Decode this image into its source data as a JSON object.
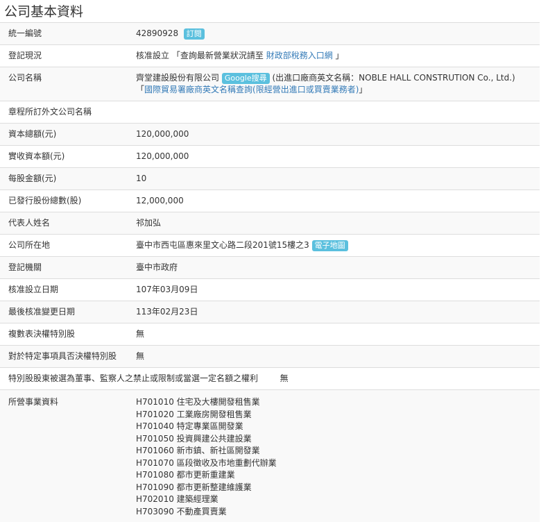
{
  "page_title": "公司基本資料",
  "rows": {
    "unified_number": {
      "label": "統一編號",
      "value": "42890928",
      "subscribe": "訂閱"
    },
    "registration_status": {
      "label": "登記現況",
      "status": "核准設立",
      "open_quote": "「查詢最新營業狀況請至",
      "link": "財政部稅務入口網",
      "close_quote": "」"
    },
    "company_name": {
      "label": "公司名稱",
      "name": "齊堂建設股份有限公司",
      "google_search": "Google搜尋",
      "english_prefix": "(出進口廠商英文名稱：NOBLE HALL CONSTRUTION Co., Ltd.)",
      "open_quote": "「",
      "trade_link": "國際貿易署廠商英文名稱查詢(限經營出進口或買賣業務者)",
      "close_quote": "」"
    },
    "foreign_name": {
      "label": "章程所訂外文公司名稱",
      "value": ""
    },
    "capital_total": {
      "label": "資本總額(元)",
      "value": "120,000,000"
    },
    "paid_in_capital": {
      "label": "實收資本額(元)",
      "value": "120,000,000"
    },
    "par_value": {
      "label": "每股金額(元)",
      "value": "10"
    },
    "issued_shares": {
      "label": "已發行股份總數(股)",
      "value": "12,000,000"
    },
    "representative": {
      "label": "代表人姓名",
      "value": "祁加弘"
    },
    "address": {
      "label": "公司所在地",
      "value": "臺中市西屯區惠來里文心路二段201號15樓之3",
      "map": "電子地圖"
    },
    "authority": {
      "label": "登記機關",
      "value": "臺中市政府"
    },
    "approval_date": {
      "label": "核准設立日期",
      "value": "107年03月09日"
    },
    "last_change_date": {
      "label": "最後核准變更日期",
      "value": "113年02月23日"
    },
    "multi_vote_shares": {
      "label": "複數表決權特別股",
      "value": "無"
    },
    "veto_shares": {
      "label": "對於特定事項具否決權特別股",
      "value": "無"
    },
    "special_share_rights": {
      "label": "特別股股東被選為董事、監察人之禁止或限制或當選一定名額之權利",
      "value": "無"
    },
    "business_items": {
      "label": "所營事業資料",
      "items": [
        "H701010  住宅及大樓開發租售業",
        "H701020  工業廠房開發租售業",
        "H701040  特定專業區開發業",
        "H701050  投資興建公共建設業",
        "H701060  新市鎮、新社區開發業",
        "H701070  區段徵收及市地重劃代辦業",
        "H701080  都市更新重建業",
        "H701090  都市更新整建維護業",
        "H702010  建築經理業",
        "H703090  不動產買賣業"
      ]
    }
  }
}
